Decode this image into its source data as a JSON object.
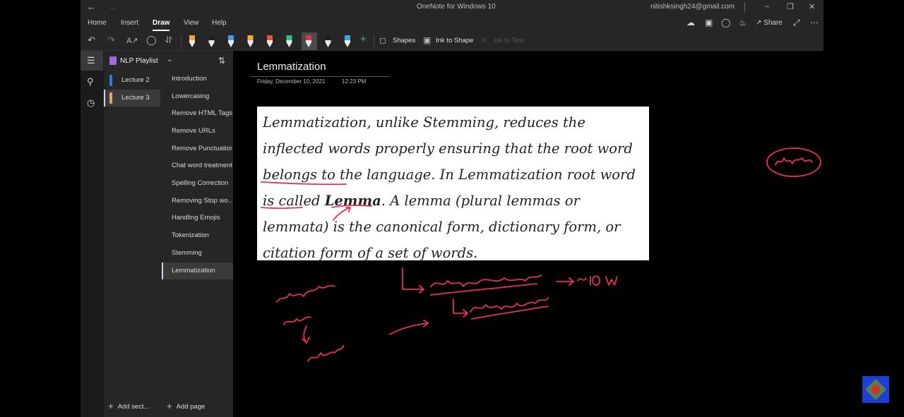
{
  "window": {
    "title": "OneNote for Windows 10",
    "user": "nitishksingh24@gmail.com"
  },
  "ribbon": {
    "tabs": [
      "Home",
      "Insert",
      "Draw",
      "View",
      "Help"
    ],
    "share_label": "Share"
  },
  "toolbar": {
    "shapes_label": "Shapes",
    "ink_to_shape_label": "Ink to Shape",
    "ink_to_text_label": "Ink to Text",
    "pens": [
      {
        "name": "highlighter-orange",
        "color": "#f0a830"
      },
      {
        "name": "pen-black",
        "color": "#202020"
      },
      {
        "name": "pen-blue",
        "color": "#3aa0e8"
      },
      {
        "name": "pen-orange",
        "color": "#f0a830"
      },
      {
        "name": "highlighter-red",
        "color": "#e8542c"
      },
      {
        "name": "pen-green",
        "color": "#2ec27e"
      },
      {
        "name": "pen-pink",
        "color": "#e0305a"
      },
      {
        "name": "pen-black-2",
        "color": "#202020"
      },
      {
        "name": "pen-blue-2",
        "color": "#3aa0e8"
      }
    ]
  },
  "notebook": {
    "name": "NLP Playlist",
    "sections": [
      {
        "label": "Lecture 2",
        "color": "#2e7bd6"
      },
      {
        "label": "Lecture 3",
        "color": "#d9a87a"
      }
    ],
    "add_section_label": "Add sect...",
    "add_page_label": "Add page"
  },
  "pages": [
    "Introduction",
    "Lowercasing",
    "Remove HTML Tags",
    "Remove URLs",
    "Remove Punctuation",
    "Chat word treatment",
    "Spelling Correction",
    "Removing Stop wo...",
    "Handling Emojis",
    "Tokenization",
    "Stemming",
    "Lemmatization"
  ],
  "page": {
    "title": "Lemmatization",
    "date": "Friday, December 10, 2021",
    "time": "12:23 PM",
    "note": {
      "part1": "Lemmatization, unlike Stemming, reduces the inflected words properly ensuring that the root word belongs to the language. In Lemmatization root word is called ",
      "bold": "Lemma",
      "part2": ". A lemma (plural lemmas or lemmata) is the canonical form, dictionary form, or citation form of a set of words."
    }
  },
  "ink_color": "#e8305a"
}
